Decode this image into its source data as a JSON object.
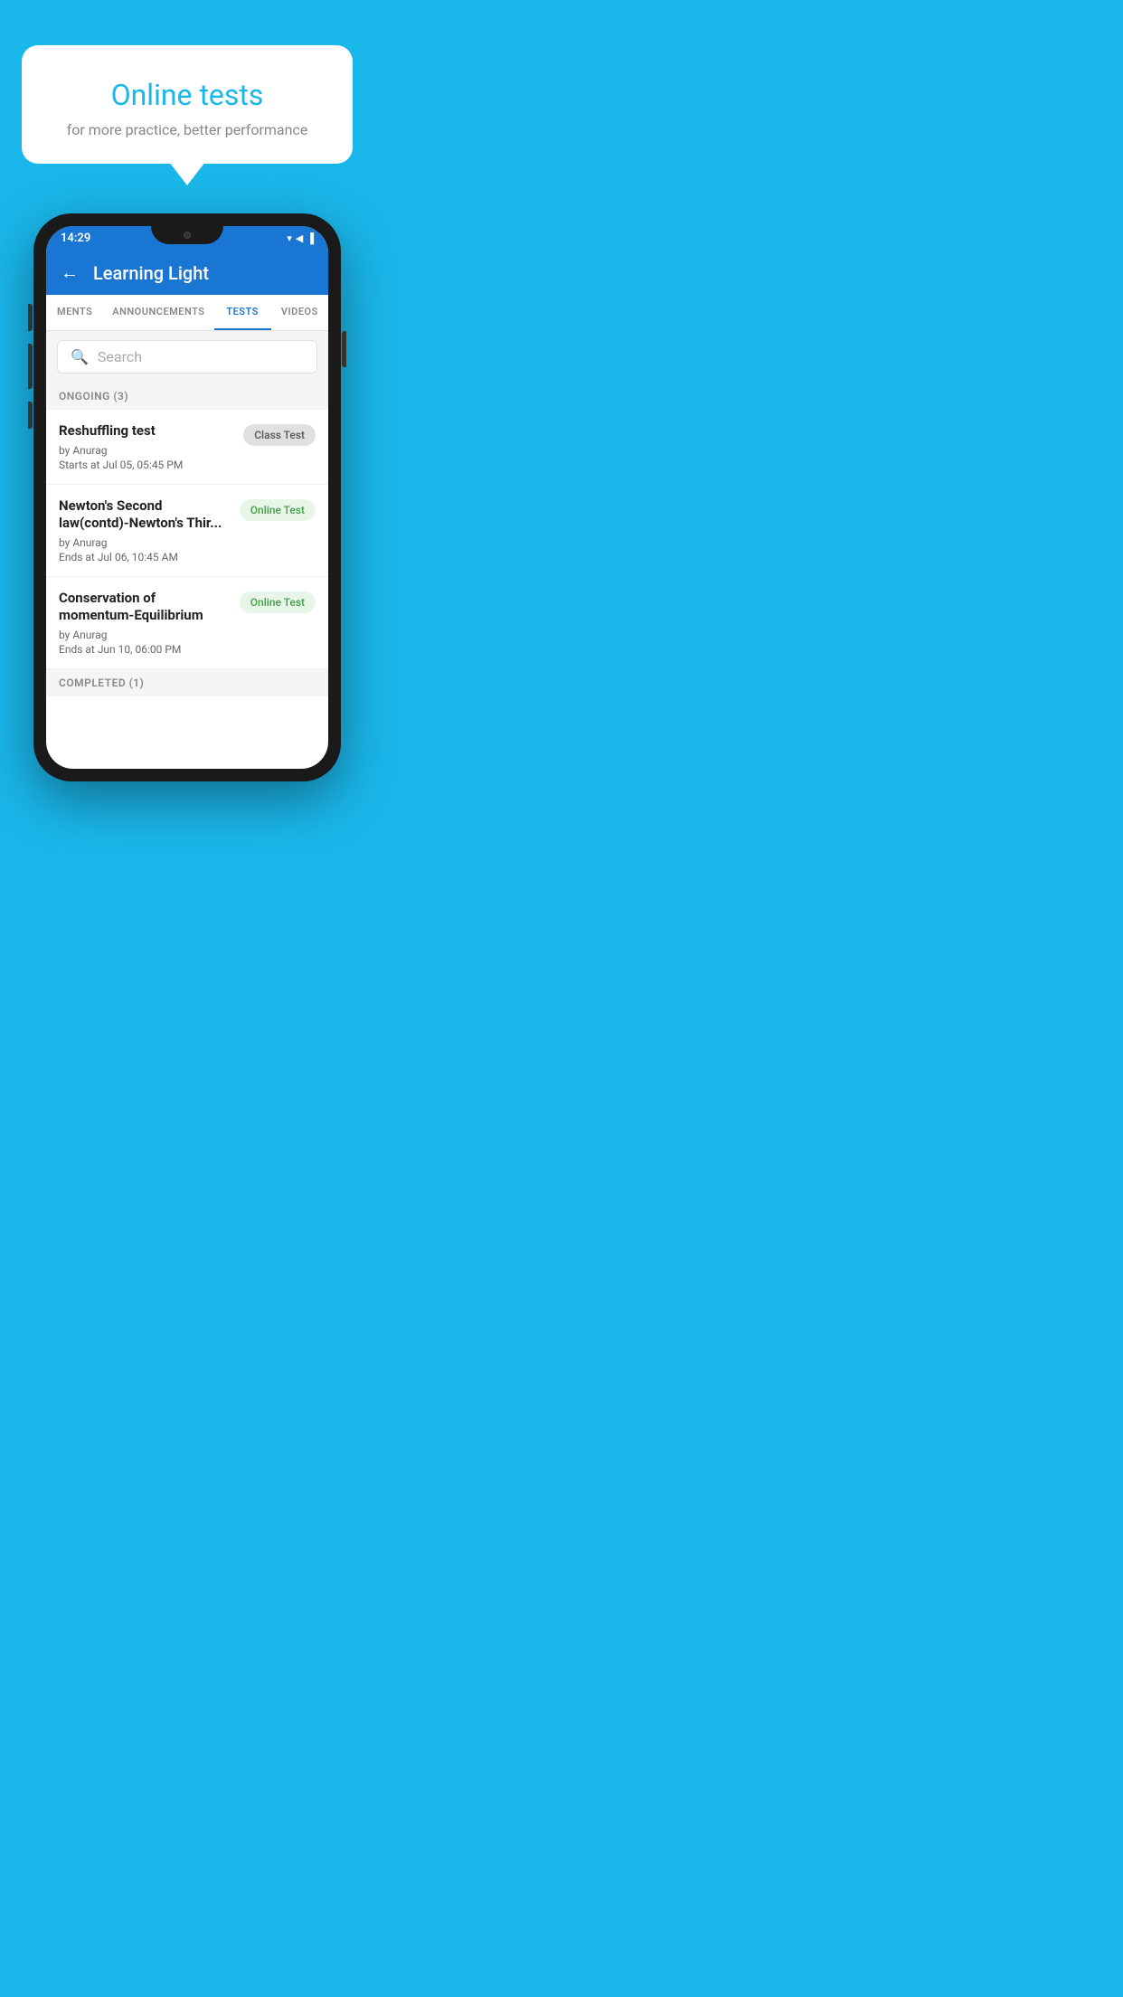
{
  "hero": {
    "title": "Online tests",
    "subtitle": "for more practice, better performance"
  },
  "statusBar": {
    "time": "14:29",
    "icons": [
      "▾",
      "◀",
      "▐"
    ]
  },
  "appBar": {
    "title": "Learning Light",
    "backLabel": "←"
  },
  "tabs": [
    {
      "label": "MENTS",
      "active": false
    },
    {
      "label": "ANNOUNCEMENTS",
      "active": false
    },
    {
      "label": "TESTS",
      "active": true
    },
    {
      "label": "VIDEOS",
      "active": false
    }
  ],
  "search": {
    "placeholder": "Search"
  },
  "ongoingSection": {
    "label": "ONGOING (3)"
  },
  "tests": [
    {
      "name": "Reshuffling test",
      "author": "by Anurag",
      "timeLabel": "Starts at  Jul 05, 05:45 PM",
      "badge": "Class Test",
      "badgeType": "class"
    },
    {
      "name": "Newton's Second law(contd)-Newton's Thir...",
      "author": "by Anurag",
      "timeLabel": "Ends at  Jul 06, 10:45 AM",
      "badge": "Online Test",
      "badgeType": "online"
    },
    {
      "name": "Conservation of momentum-Equilibrium",
      "author": "by Anurag",
      "timeLabel": "Ends at  Jun 10, 06:00 PM",
      "badge": "Online Test",
      "badgeType": "online"
    }
  ],
  "completedSection": {
    "label": "COMPLETED (1)"
  }
}
